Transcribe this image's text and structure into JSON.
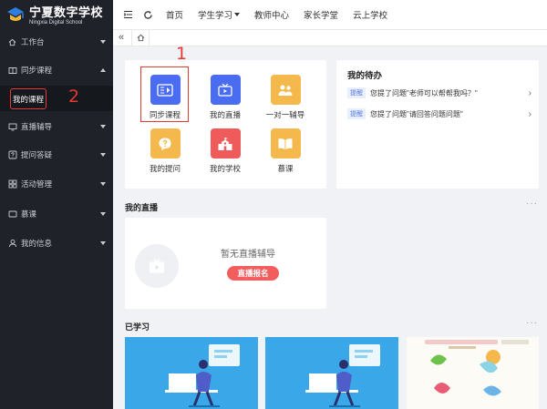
{
  "logo": {
    "title": "宁夏数字学校",
    "subtitle": "Ningxia Digital School"
  },
  "sidebar": {
    "items": [
      {
        "label": "工作台",
        "icon": "house-icon"
      },
      {
        "label": "同步课程",
        "icon": "book-icon",
        "expanded": true
      },
      {
        "label": "直播辅导",
        "icon": "monitor-icon"
      },
      {
        "label": "提问答疑",
        "icon": "question-icon"
      },
      {
        "label": "活动管理",
        "icon": "grid-icon"
      },
      {
        "label": "慕课",
        "icon": "screen-icon"
      },
      {
        "label": "我的信息",
        "icon": "person-icon"
      }
    ],
    "sub_item": "我的课程"
  },
  "annotations": {
    "one": "1",
    "two": "2"
  },
  "topnav": {
    "items": [
      "首页",
      "学生学习",
      "教师中心",
      "家长学堂",
      "云上学校"
    ]
  },
  "apps": [
    {
      "label": "同步课程",
      "color": "#4a6cf0",
      "icon": "video-card-icon"
    },
    {
      "label": "我的直播",
      "color": "#4a6cf0",
      "icon": "tv-icon"
    },
    {
      "label": "一对一辅导",
      "color": "#f5b84c",
      "icon": "people-icon"
    },
    {
      "label": "我的提问",
      "color": "#f5b84c",
      "icon": "question-bubble-icon"
    },
    {
      "label": "我的学校",
      "color": "#ef5a5a",
      "icon": "school-icon"
    },
    {
      "label": "慕课",
      "color": "#f5b84c",
      "icon": "open-book-icon"
    }
  ],
  "todo": {
    "title": "我的待办",
    "items": [
      {
        "badge": "提醒",
        "text": "您提了问题\"老师可以帮帮我吗？\""
      },
      {
        "badge": "提醒",
        "text": "您提了问题\"请回答问题问题\""
      }
    ]
  },
  "live": {
    "title": "我的直播",
    "empty_text": "暂无直播辅导",
    "button": "直播报名"
  },
  "learned": {
    "title": "已学习"
  },
  "colors": {
    "sidebar": "#1f2329",
    "accent": "#4a6cf0",
    "annotation": "#e53935",
    "course_bg": "#3aa7e8"
  }
}
